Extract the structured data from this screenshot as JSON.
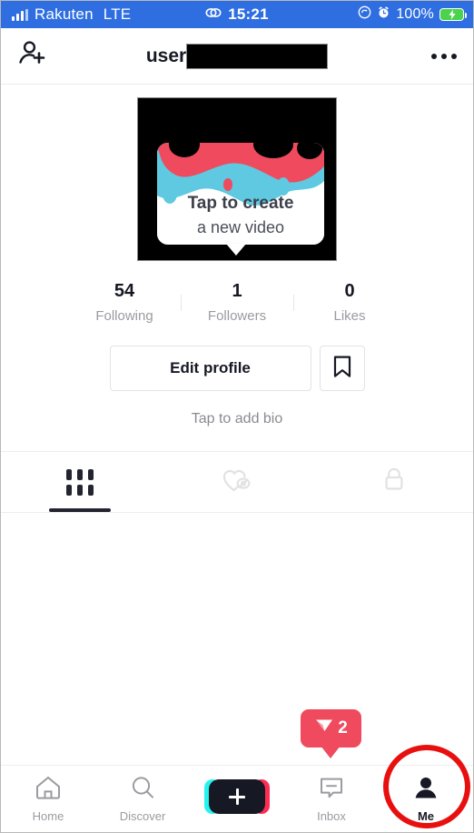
{
  "status_bar": {
    "carrier": "Rakuten",
    "network": "LTE",
    "time": "15:21",
    "battery_percent": "100%",
    "signal_icon": "signal-bars-icon",
    "link_icon": "link-chain-icon",
    "rotation_lock_icon": "rotation-lock-icon",
    "alarm_icon": "alarm-clock-icon",
    "battery_icon": "battery-charging-icon",
    "bg_color": "#2f6ee0"
  },
  "header": {
    "add_friend_icon": "add-person-icon",
    "username_visible": "user",
    "username_redacted": true,
    "more_icon": "more-options-icon"
  },
  "profile": {
    "avatar_redacted": true,
    "stats": [
      {
        "value": "54",
        "label": "Following"
      },
      {
        "value": "1",
        "label": "Followers"
      },
      {
        "value": "0",
        "label": "Likes"
      }
    ],
    "edit_button": "Edit profile",
    "bookmark_icon": "bookmark-icon",
    "bio_placeholder": "Tap to add bio"
  },
  "tabs": [
    {
      "name": "videos",
      "icon": "grid-icon",
      "active": true
    },
    {
      "name": "liked",
      "icon": "heart-hidden-icon",
      "active": false
    },
    {
      "name": "private",
      "icon": "lock-icon",
      "active": false
    }
  ],
  "create_tooltip": {
    "line1": "Tap to create",
    "line2": "a new video",
    "art_colors": [
      "#ef4a5e",
      "#5ec9e0",
      "#000000"
    ]
  },
  "send_badge": {
    "count": "2",
    "icon": "send-plane-icon",
    "color": "#ef4a5e"
  },
  "bottom_nav": {
    "items": [
      {
        "label": "Home",
        "icon": "home-icon",
        "active": false
      },
      {
        "label": "Discover",
        "icon": "search-icon",
        "active": false
      },
      {
        "label": "",
        "icon": "create-plus-icon",
        "active": false
      },
      {
        "label": "Inbox",
        "icon": "inbox-message-icon",
        "active": false
      },
      {
        "label": "Me",
        "icon": "person-icon",
        "active": true
      }
    ],
    "create_colors": {
      "left": "#25f4ee",
      "right": "#fe2c55",
      "center": "#161823"
    }
  },
  "annotation": {
    "shape": "circle",
    "color": "#e8100f",
    "target": "Me"
  }
}
